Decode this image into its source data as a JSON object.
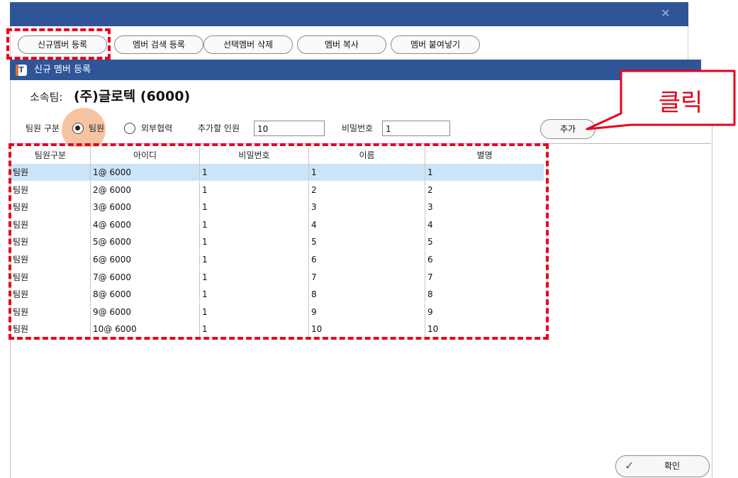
{
  "outer_window": {
    "close_glyph": "✕",
    "toolbar": [
      {
        "label": "신규멤버 등록"
      },
      {
        "label": "멤버 검색 등록"
      },
      {
        "label": "선택멤버 삭제"
      },
      {
        "label": "멤버 복사"
      },
      {
        "label": "멤버 붙여넣기"
      }
    ]
  },
  "dialog": {
    "logo_letter": "T",
    "title": "신규 멤버 등록",
    "team_label": "소속팀:",
    "team_name": "(주)글로텍 (6000)",
    "member_type_label": "팀원 구분",
    "radio_team": {
      "label": "팀원",
      "selected": true
    },
    "radio_partner": {
      "label": "외부협력",
      "selected": false
    },
    "count_label": "추가할 인원",
    "count_value": "10",
    "password_label": "비밀번호",
    "password_value": "1",
    "add_button": "추가",
    "ok_button": "확인",
    "ok_icon": "✓"
  },
  "grid": {
    "columns": [
      "팀원구분",
      "아이디",
      "비밀번호",
      "이름",
      "별명"
    ],
    "rows": [
      [
        "팀원",
        "1@ 6000",
        "1",
        "1",
        "1"
      ],
      [
        "팀원",
        "2@ 6000",
        "1",
        "2",
        "2"
      ],
      [
        "팀원",
        "3@ 6000",
        "1",
        "3",
        "3"
      ],
      [
        "팀원",
        "4@ 6000",
        "1",
        "4",
        "4"
      ],
      [
        "팀원",
        "5@ 6000",
        "1",
        "5",
        "5"
      ],
      [
        "팀원",
        "6@ 6000",
        "1",
        "6",
        "6"
      ],
      [
        "팀원",
        "7@ 6000",
        "1",
        "7",
        "7"
      ],
      [
        "팀원",
        "8@ 6000",
        "1",
        "8",
        "8"
      ],
      [
        "팀원",
        "9@ 6000",
        "1",
        "9",
        "9"
      ],
      [
        "팀원",
        "10@ 6000",
        "1",
        "10",
        "10"
      ]
    ],
    "selected_row": 0
  },
  "annotation": {
    "callout_text": "클릭",
    "color": "#e8001c",
    "highlight_color": "#f4b084"
  }
}
